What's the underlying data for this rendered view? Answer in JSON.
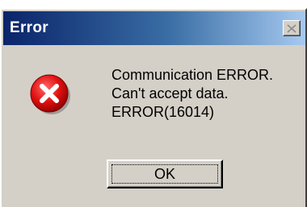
{
  "dialog": {
    "title": "Error",
    "close_icon": "close-icon",
    "icon": "error-icon",
    "message_lines": [
      "Communication ERROR.",
      "Can't accept data.",
      "ERROR(16014)"
    ],
    "ok_label": "OK"
  },
  "colors": {
    "titlebar_start": "#0a246a",
    "titlebar_end": "#a6caf0",
    "face": "#d4d0c8",
    "error_red": "#e01010"
  }
}
